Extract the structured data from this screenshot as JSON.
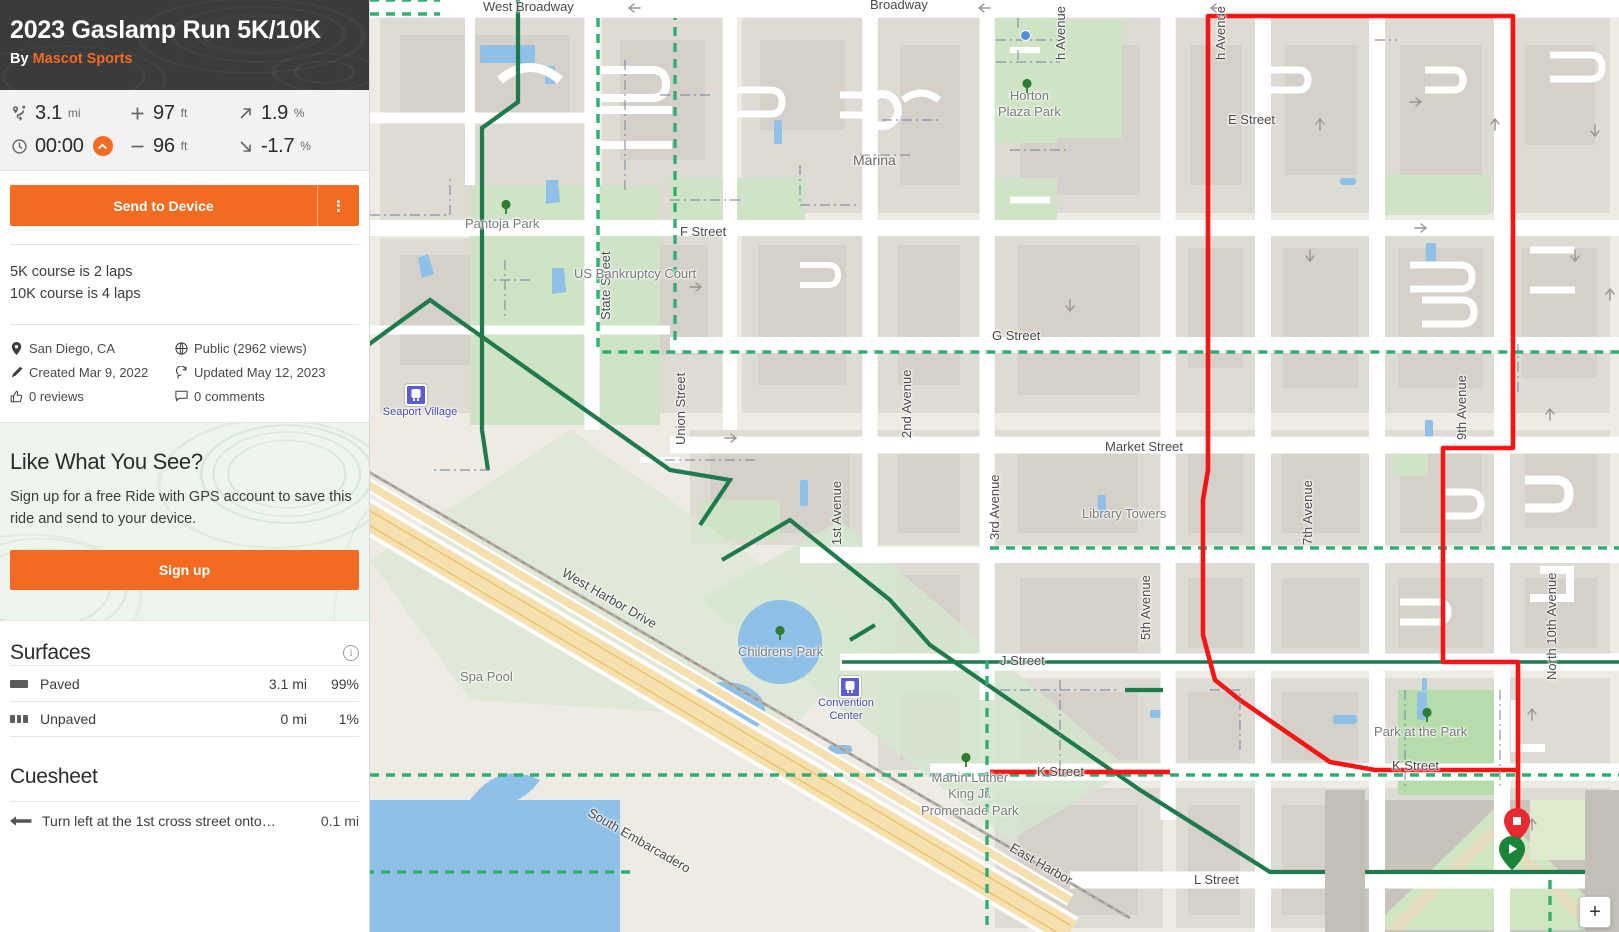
{
  "header": {
    "title": "2023 Gaslamp Run 5K/10K",
    "by_label": "By",
    "author": "Mascot Sports"
  },
  "stats": {
    "distance": {
      "icon": "route-icon",
      "value": "3.1",
      "unit": "mi"
    },
    "ascent": {
      "icon": "plus-icon",
      "value": "97",
      "unit": "ft"
    },
    "max_grade": {
      "icon": "arrow-up-right-icon",
      "value": "1.9",
      "unit": "%"
    },
    "time": {
      "icon": "clock-icon",
      "value": "00:00",
      "badge": "chevron-up-icon"
    },
    "descent": {
      "icon": "minus-icon",
      "value": "96",
      "unit": "ft"
    },
    "min_grade": {
      "icon": "arrow-down-right-icon",
      "value": "-1.7",
      "unit": "%"
    }
  },
  "actions": {
    "send_to_device": "Send to Device",
    "more_menu": "kebab-icon"
  },
  "description": {
    "line1": "5K course is 2 laps",
    "line2": "10K course is 4 laps"
  },
  "meta": {
    "location": "San Diego, CA",
    "visibility": "Public (2962 views)",
    "created": "Created Mar 9, 2022",
    "updated": "Updated May 12, 2023",
    "reviews": "0 reviews",
    "comments": "0 comments"
  },
  "signup": {
    "heading": "Like What You See?",
    "body": "Sign up for a free Ride with GPS account to save this ride and send to your device.",
    "button": "Sign up"
  },
  "surfaces": {
    "heading": "Surfaces",
    "info_icon": "info-icon",
    "rows": [
      {
        "name": "Paved",
        "distance": "3.1 mi",
        "percent": "99%",
        "swatch": "solid"
      },
      {
        "name": "Unpaved",
        "distance": "0 mi",
        "percent": "1%",
        "swatch": "dashed"
      }
    ]
  },
  "cuesheet": {
    "heading": "Cuesheet",
    "rows": [
      {
        "icon": "arrow-left-icon",
        "text": "Turn left at the 1st cross street onto…",
        "distance": "0.1 mi"
      }
    ]
  },
  "map": {
    "zoom_in_label": "+",
    "markers": [
      {
        "type": "finish-marker",
        "color": "#e8292f",
        "glyph": "square"
      },
      {
        "type": "start-marker",
        "color": "#1a8438",
        "glyph": "play"
      }
    ],
    "route_color": "#f41515",
    "bike_route_color": "#1f7a4d",
    "street_labels": [
      "West Broadway",
      "Broadway",
      "E Street",
      "F Street",
      "G Street",
      "Market Street",
      "J Street",
      "K Street",
      "L Street",
      "State Street",
      "Union Street",
      "1st Avenue",
      "2nd Avenue",
      "3rd Avenue",
      "5th Avenue",
      "7th Avenue",
      "9th Avenue",
      "North 10th Avenue",
      "West Harbor Drive",
      "South Embarcadero",
      "East Harbor"
    ],
    "place_labels": [
      "Pantoja Park",
      "US Bankruptcy Court",
      "Marina",
      "Horton Plaza Park",
      "Library Towers",
      "Childrens Park",
      "Spa Pool",
      "Park at the Park",
      "Martin Luther King Jr. Promenade Park"
    ],
    "transit_labels": [
      "Seaport Village",
      "Convention Center"
    ]
  }
}
